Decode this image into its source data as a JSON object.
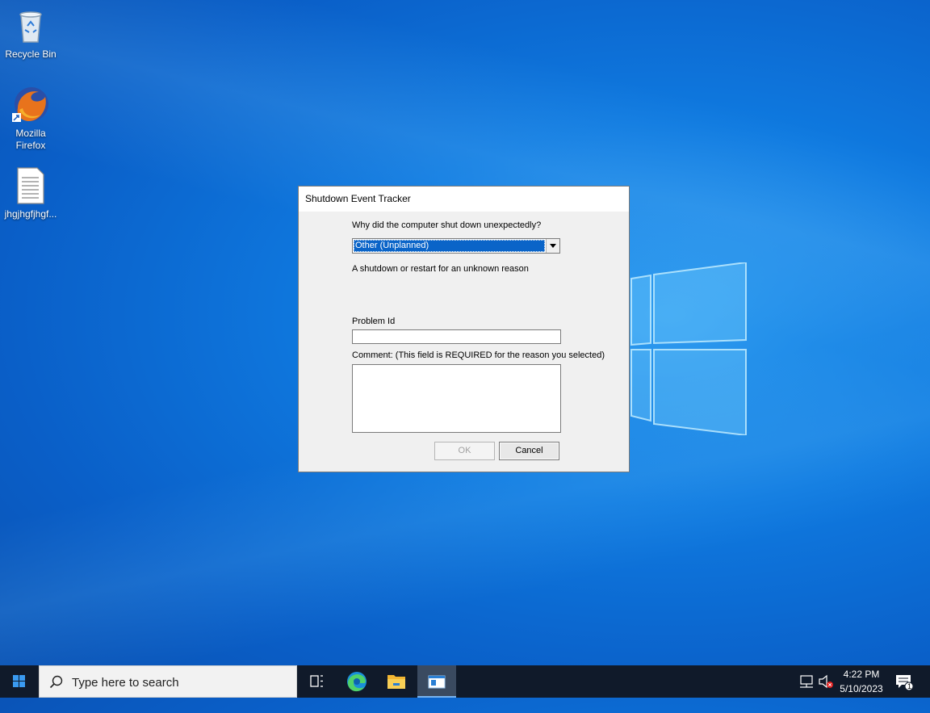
{
  "desktop": {
    "icons": [
      {
        "label": "Recycle Bin"
      },
      {
        "label": "Mozilla Firefox"
      },
      {
        "label": "jhgjhgfjhgf..."
      }
    ]
  },
  "dialog": {
    "title": "Shutdown Event Tracker",
    "question": "Why did the computer shut down unexpectedly?",
    "reason_selected": "Other (Unplanned)",
    "reason_description": "A shutdown or restart for an unknown reason",
    "problem_id_label": "Problem Id",
    "problem_id_value": "",
    "comment_label": "Comment: (This field is REQUIRED for the reason you selected)",
    "comment_value": "",
    "ok_label": "OK",
    "cancel_label": "Cancel"
  },
  "taskbar": {
    "search_placeholder": "Type here to search",
    "time": "4:22 PM",
    "date": "5/10/2023",
    "notification_count": "1",
    "apps": [
      "task-view",
      "edge",
      "file-explorer",
      "shutdown-event-tracker"
    ]
  },
  "colors": {
    "desktop_blue": "#0f7ae0",
    "selection": "#0a64c8",
    "taskbar": "#101a2a"
  }
}
